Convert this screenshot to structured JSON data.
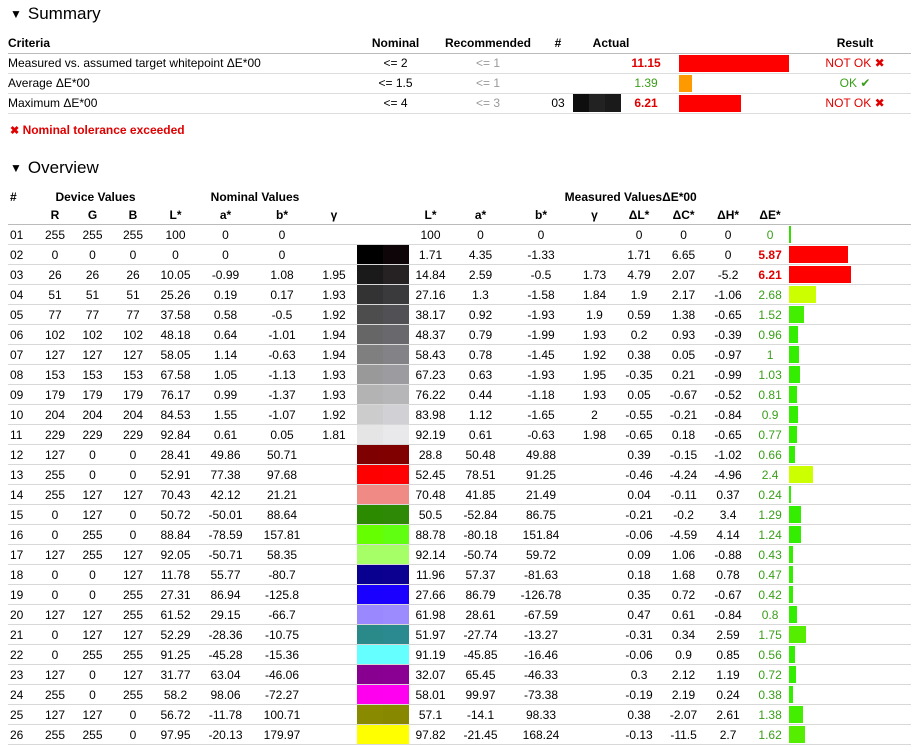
{
  "summary": {
    "title": "Summary",
    "headers": {
      "criteria": "Criteria",
      "nominal": "Nominal",
      "recommended": "Recommended",
      "num": "#",
      "actual": "Actual",
      "result": "Result"
    },
    "rows": [
      {
        "criteria": "Measured vs. assumed target whitepoint ΔE*00",
        "nominal": "<= 2",
        "recommended": "<= 1",
        "num": "",
        "actual": "11.15",
        "actual_color": "#e00000",
        "actual_bold": true,
        "bar_pct": 100,
        "bar_color": "#ff0000",
        "result": "NOT OK",
        "result_icon": "✖",
        "ok": false
      },
      {
        "criteria": "Average ΔE*00",
        "nominal": "<= 1.5",
        "recommended": "<= 1",
        "num": "",
        "actual": "1.39",
        "actual_color": "#3a9e1a",
        "actual_bold": false,
        "bar_pct": 12,
        "bar_color": "#ff9900",
        "result": "OK",
        "result_icon": "✔",
        "ok": true
      },
      {
        "criteria": "Maximum ΔE*00",
        "nominal": "<= 4",
        "recommended": "<= 3",
        "num": "03",
        "actual": "6.21",
        "actual_color": "#e00000",
        "actual_bold": true,
        "bar_pct": 56,
        "bar_color": "#ff0000",
        "result": "NOT OK",
        "result_icon": "✖",
        "ok": false,
        "swatch": [
          "#0e0e0e",
          "#222222",
          "#1a1a1a"
        ]
      }
    ],
    "note_icon": "✖",
    "note": "Nominal tolerance exceeded"
  },
  "overview": {
    "title": "Overview",
    "group_headers": {
      "num": "#",
      "device": "Device Values",
      "nominal": "Nominal Values",
      "measured": "Measured Values",
      "de": "ΔE*00"
    },
    "sub_headers": [
      "R",
      "G",
      "B",
      "L*",
      "a*",
      "b*",
      "γ",
      "L*",
      "a*",
      "b*",
      "γ",
      "ΔL*",
      "ΔC*",
      "ΔH*",
      "ΔE*"
    ],
    "rows": [
      {
        "id": "01",
        "r": "255",
        "g": "255",
        "b": "255",
        "nl": "100",
        "na": "0",
        "nb": "0",
        "ng": "",
        "ml": "100",
        "ma": "0",
        "mb": "0",
        "mg": "",
        "dl": "0",
        "dc": "0",
        "dh": "0",
        "de": "0",
        "de_color": "#3a9e1a",
        "de_bold": false,
        "bar": 0,
        "bar_color": "#33dd00",
        "sw1": "#ffffff",
        "sw2": "#ffffff"
      },
      {
        "id": "02",
        "r": "0",
        "g": "0",
        "b": "0",
        "nl": "0",
        "na": "0",
        "nb": "0",
        "ng": "",
        "ml": "1.71",
        "ma": "4.35",
        "mb": "-1.33",
        "mg": "",
        "dl": "1.71",
        "dc": "6.65",
        "dh": "0",
        "de": "5.87",
        "de_color": "#e00000",
        "de_bold": true,
        "bar": 95,
        "bar_color": "#ff0000",
        "sw1": "#000000",
        "sw2": "#0d0508"
      },
      {
        "id": "03",
        "r": "26",
        "g": "26",
        "b": "26",
        "nl": "10.05",
        "na": "-0.99",
        "nb": "1.08",
        "ng": "1.95",
        "ml": "14.84",
        "ma": "2.59",
        "mb": "-0.5",
        "mg": "1.73",
        "dl": "4.79",
        "dc": "2.07",
        "dh": "-5.2",
        "de": "6.21",
        "de_color": "#e00000",
        "de_bold": true,
        "bar": 100,
        "bar_color": "#ff0000",
        "sw1": "#1a1a1a",
        "sw2": "#262223"
      },
      {
        "id": "04",
        "r": "51",
        "g": "51",
        "b": "51",
        "nl": "25.26",
        "na": "0.19",
        "nb": "0.17",
        "ng": "1.93",
        "ml": "27.16",
        "ma": "1.3",
        "mb": "-1.58",
        "mg": "1.84",
        "dl": "1.9",
        "dc": "2.17",
        "dh": "-1.06",
        "de": "2.68",
        "de_color": "#3a9e1a",
        "de_bold": false,
        "bar": 43,
        "bar_color": "#ccff00",
        "sw1": "#333333",
        "sw2": "#3a3a3d"
      },
      {
        "id": "05",
        "r": "77",
        "g": "77",
        "b": "77",
        "nl": "37.58",
        "na": "0.58",
        "nb": "-0.5",
        "ng": "1.92",
        "ml": "38.17",
        "ma": "0.92",
        "mb": "-1.93",
        "mg": "1.9",
        "dl": "0.59",
        "dc": "1.38",
        "dh": "-0.65",
        "de": "1.52",
        "de_color": "#3a9e1a",
        "de_bold": false,
        "bar": 24,
        "bar_color": "#44ee00",
        "sw1": "#4d4d4d",
        "sw2": "#515155"
      },
      {
        "id": "06",
        "r": "102",
        "g": "102",
        "b": "102",
        "nl": "48.18",
        "na": "0.64",
        "nb": "-1.01",
        "ng": "1.94",
        "ml": "48.37",
        "ma": "0.79",
        "mb": "-1.99",
        "mg": "1.93",
        "dl": "0.2",
        "dc": "0.93",
        "dh": "-0.39",
        "de": "0.96",
        "de_color": "#3a9e1a",
        "de_bold": false,
        "bar": 15,
        "bar_color": "#33ee00",
        "sw1": "#666666",
        "sw2": "#69696d"
      },
      {
        "id": "07",
        "r": "127",
        "g": "127",
        "b": "127",
        "nl": "58.05",
        "na": "1.14",
        "nb": "-0.63",
        "ng": "1.94",
        "ml": "58.43",
        "ma": "0.78",
        "mb": "-1.45",
        "mg": "1.92",
        "dl": "0.38",
        "dc": "0.05",
        "dh": "-0.97",
        "de": "1",
        "de_color": "#3a9e1a",
        "de_bold": false,
        "bar": 16,
        "bar_color": "#33ee00",
        "sw1": "#7f7f7f",
        "sw2": "#838387"
      },
      {
        "id": "08",
        "r": "153",
        "g": "153",
        "b": "153",
        "nl": "67.58",
        "na": "1.05",
        "nb": "-1.13",
        "ng": "1.93",
        "ml": "67.23",
        "ma": "0.63",
        "mb": "-1.93",
        "mg": "1.95",
        "dl": "-0.35",
        "dc": "0.21",
        "dh": "-0.99",
        "de": "1.03",
        "de_color": "#3a9e1a",
        "de_bold": false,
        "bar": 17,
        "bar_color": "#33ee00",
        "sw1": "#999999",
        "sw2": "#9c9ca0"
      },
      {
        "id": "09",
        "r": "179",
        "g": "179",
        "b": "179",
        "nl": "76.17",
        "na": "0.99",
        "nb": "-1.37",
        "ng": "1.93",
        "ml": "76.22",
        "ma": "0.44",
        "mb": "-1.18",
        "mg": "1.93",
        "dl": "0.05",
        "dc": "-0.67",
        "dh": "-0.52",
        "de": "0.81",
        "de_color": "#3a9e1a",
        "de_bold": false,
        "bar": 13,
        "bar_color": "#33ee00",
        "sw1": "#b3b3b3",
        "sw2": "#b6b6b9"
      },
      {
        "id": "10",
        "r": "204",
        "g": "204",
        "b": "204",
        "nl": "84.53",
        "na": "1.55",
        "nb": "-1.07",
        "ng": "1.92",
        "ml": "83.98",
        "ma": "1.12",
        "mb": "-1.65",
        "mg": "2",
        "dl": "-0.55",
        "dc": "-0.21",
        "dh": "-0.84",
        "de": "0.9",
        "de_color": "#3a9e1a",
        "de_bold": false,
        "bar": 14,
        "bar_color": "#33ee00",
        "sw1": "#cccccc",
        "sw2": "#d1d1d5"
      },
      {
        "id": "11",
        "r": "229",
        "g": "229",
        "b": "229",
        "nl": "92.84",
        "na": "0.61",
        "nb": "0.05",
        "ng": "1.81",
        "ml": "92.19",
        "ma": "0.61",
        "mb": "-0.63",
        "mg": "1.98",
        "dl": "-0.65",
        "dc": "0.18",
        "dh": "-0.65",
        "de": "0.77",
        "de_color": "#3a9e1a",
        "de_bold": false,
        "bar": 12,
        "bar_color": "#33ee00",
        "sw1": "#e5e5e5",
        "sw2": "#e9e9ec"
      },
      {
        "id": "12",
        "r": "127",
        "g": "0",
        "b": "0",
        "nl": "28.41",
        "na": "49.86",
        "nb": "50.71",
        "ng": "",
        "ml": "28.8",
        "ma": "50.48",
        "mb": "49.88",
        "mg": "",
        "dl": "0.39",
        "dc": "-0.15",
        "dh": "-1.02",
        "de": "0.66",
        "de_color": "#3a9e1a",
        "de_bold": false,
        "bar": 10,
        "bar_color": "#33ee00",
        "sw1": "#7f0000",
        "sw2": "#800000"
      },
      {
        "id": "13",
        "r": "255",
        "g": "0",
        "b": "0",
        "nl": "52.91",
        "na": "77.38",
        "nb": "97.68",
        "ng": "",
        "ml": "52.45",
        "ma": "78.51",
        "mb": "91.25",
        "mg": "",
        "dl": "-0.46",
        "dc": "-4.24",
        "dh": "-4.96",
        "de": "2.4",
        "de_color": "#3a9e1a",
        "de_bold": false,
        "bar": 39,
        "bar_color": "#ccff00",
        "sw1": "#ff0000",
        "sw2": "#ff0004"
      },
      {
        "id": "14",
        "r": "255",
        "g": "127",
        "b": "127",
        "nl": "70.43",
        "na": "42.12",
        "nb": "21.21",
        "ng": "",
        "ml": "70.48",
        "ma": "41.85",
        "mb": "21.49",
        "mg": "",
        "dl": "0.04",
        "dc": "-0.11",
        "dh": "0.37",
        "de": "0.24",
        "de_color": "#3a9e1a",
        "de_bold": false,
        "bar": 3,
        "bar_color": "#33ee00",
        "sw1": "#f08a84",
        "sw2": "#f08a84"
      },
      {
        "id": "15",
        "r": "0",
        "g": "127",
        "b": "0",
        "nl": "50.72",
        "na": "-50.01",
        "nb": "88.64",
        "ng": "",
        "ml": "50.5",
        "ma": "-52.84",
        "mb": "86.75",
        "mg": "",
        "dl": "-0.21",
        "dc": "-0.2",
        "dh": "3.4",
        "de": "1.29",
        "de_color": "#3a9e1a",
        "de_bold": false,
        "bar": 20,
        "bar_color": "#33ee00",
        "sw1": "#2b8a00",
        "sw2": "#2e8a06"
      },
      {
        "id": "16",
        "r": "0",
        "g": "255",
        "b": "0",
        "nl": "88.84",
        "na": "-78.59",
        "nb": "157.81",
        "ng": "",
        "ml": "88.78",
        "ma": "-80.18",
        "mb": "151.84",
        "mg": "",
        "dl": "-0.06",
        "dc": "-4.59",
        "dh": "4.14",
        "de": "1.24",
        "de_color": "#3a9e1a",
        "de_bold": false,
        "bar": 20,
        "bar_color": "#33ee00",
        "sw1": "#66ff00",
        "sw2": "#60ff12"
      },
      {
        "id": "17",
        "r": "127",
        "g": "255",
        "b": "127",
        "nl": "92.05",
        "na": "-50.71",
        "nb": "58.35",
        "ng": "",
        "ml": "92.14",
        "ma": "-50.74",
        "mb": "59.72",
        "mg": "",
        "dl": "0.09",
        "dc": "1.06",
        "dh": "-0.88",
        "de": "0.43",
        "de_color": "#3a9e1a",
        "de_bold": false,
        "bar": 6,
        "bar_color": "#33ee00",
        "sw1": "#a6ff66",
        "sw2": "#a6ff66"
      },
      {
        "id": "18",
        "r": "0",
        "g": "0",
        "b": "127",
        "nl": "11.78",
        "na": "55.77",
        "nb": "-80.7",
        "ng": "",
        "ml": "11.96",
        "ma": "57.37",
        "mb": "-81.63",
        "mg": "",
        "dl": "0.18",
        "dc": "1.68",
        "dh": "0.78",
        "de": "0.47",
        "de_color": "#3a9e1a",
        "de_bold": false,
        "bar": 7,
        "bar_color": "#33ee00",
        "sw1": "#0a0090",
        "sw2": "#0c0090"
      },
      {
        "id": "19",
        "r": "0",
        "g": "0",
        "b": "255",
        "nl": "27.31",
        "na": "86.94",
        "nb": "-125.8",
        "ng": "",
        "ml": "27.66",
        "ma": "86.79",
        "mb": "-126.78",
        "mg": "",
        "dl": "0.35",
        "dc": "0.72",
        "dh": "-0.67",
        "de": "0.42",
        "de_color": "#3a9e1a",
        "de_bold": false,
        "bar": 6,
        "bar_color": "#33ee00",
        "sw1": "#1a00ff",
        "sw2": "#1c00ff"
      },
      {
        "id": "20",
        "r": "127",
        "g": "127",
        "b": "255",
        "nl": "61.52",
        "na": "29.15",
        "nb": "-66.7",
        "ng": "",
        "ml": "61.98",
        "ma": "28.61",
        "mb": "-67.59",
        "mg": "",
        "dl": "0.47",
        "dc": "0.61",
        "dh": "-0.84",
        "de": "0.8",
        "de_color": "#3a9e1a",
        "de_bold": false,
        "bar": 13,
        "bar_color": "#33ee00",
        "sw1": "#9a88ff",
        "sw2": "#9c8aff"
      },
      {
        "id": "21",
        "r": "0",
        "g": "127",
        "b": "127",
        "nl": "52.29",
        "na": "-28.36",
        "nb": "-10.75",
        "ng": "",
        "ml": "51.97",
        "ma": "-27.74",
        "mb": "-13.27",
        "mg": "",
        "dl": "-0.31",
        "dc": "0.34",
        "dh": "2.59",
        "de": "1.75",
        "de_color": "#3a9e1a",
        "de_bold": false,
        "bar": 28,
        "bar_color": "#55ee00",
        "sw1": "#2a8a8a",
        "sw2": "#2a8a90"
      },
      {
        "id": "22",
        "r": "0",
        "g": "255",
        "b": "255",
        "nl": "91.25",
        "na": "-45.28",
        "nb": "-15.36",
        "ng": "",
        "ml": "91.19",
        "ma": "-45.85",
        "mb": "-16.46",
        "mg": "",
        "dl": "-0.06",
        "dc": "0.9",
        "dh": "0.85",
        "de": "0.56",
        "de_color": "#3a9e1a",
        "de_bold": false,
        "bar": 9,
        "bar_color": "#33ee00",
        "sw1": "#66ffff",
        "sw2": "#66ffff"
      },
      {
        "id": "23",
        "r": "127",
        "g": "0",
        "b": "127",
        "nl": "31.77",
        "na": "63.04",
        "nb": "-46.06",
        "ng": "",
        "ml": "32.07",
        "ma": "65.45",
        "mb": "-46.33",
        "mg": "",
        "dl": "0.3",
        "dc": "2.12",
        "dh": "1.19",
        "de": "0.72",
        "de_color": "#3a9e1a",
        "de_bold": false,
        "bar": 11,
        "bar_color": "#33ee00",
        "sw1": "#880090",
        "sw2": "#8a0092"
      },
      {
        "id": "24",
        "r": "255",
        "g": "0",
        "b": "255",
        "nl": "58.2",
        "na": "98.06",
        "nb": "-72.27",
        "ng": "",
        "ml": "58.01",
        "ma": "99.97",
        "mb": "-73.38",
        "mg": "",
        "dl": "-0.19",
        "dc": "2.19",
        "dh": "0.24",
        "de": "0.38",
        "de_color": "#3a9e1a",
        "de_bold": false,
        "bar": 6,
        "bar_color": "#33ee00",
        "sw1": "#ff00ee",
        "sw2": "#ff00f0"
      },
      {
        "id": "25",
        "r": "127",
        "g": "127",
        "b": "0",
        "nl": "56.72",
        "na": "-11.78",
        "nb": "100.71",
        "ng": "",
        "ml": "57.1",
        "ma": "-14.1",
        "mb": "98.33",
        "mg": "",
        "dl": "0.38",
        "dc": "-2.07",
        "dh": "2.61",
        "de": "1.38",
        "de_color": "#3a9e1a",
        "de_bold": false,
        "bar": 22,
        "bar_color": "#44ee00",
        "sw1": "#8a8a00",
        "sw2": "#888800"
      },
      {
        "id": "26",
        "r": "255",
        "g": "255",
        "b": "0",
        "nl": "97.95",
        "na": "-20.13",
        "nb": "179.97",
        "ng": "",
        "ml": "97.82",
        "ma": "-21.45",
        "mb": "168.24",
        "mg": "",
        "dl": "-0.13",
        "dc": "-11.5",
        "dh": "2.7",
        "de": "1.62",
        "de_color": "#3a9e1a",
        "de_bold": false,
        "bar": 26,
        "bar_color": "#55ee00",
        "sw1": "#ffff00",
        "sw2": "#ffff00"
      }
    ]
  }
}
